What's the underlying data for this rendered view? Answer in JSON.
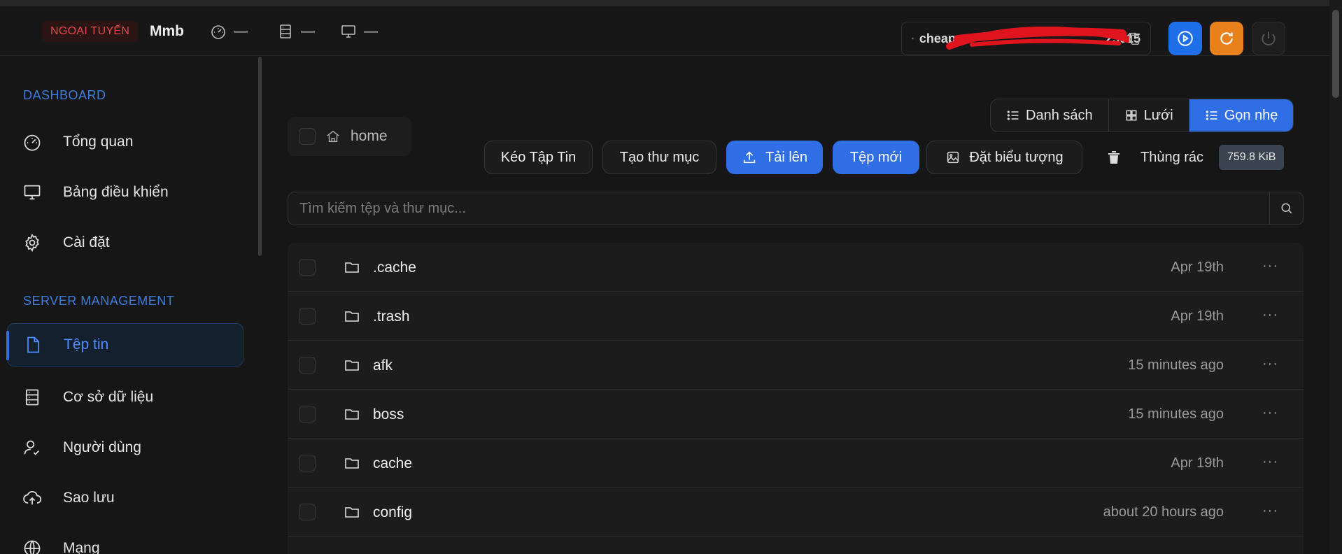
{
  "header": {
    "status": "NGOẠI TUYẾN",
    "server_name": "Mmb",
    "cpu": "—",
    "memory": "—",
    "disk": "—",
    "address_prefix": "cheap",
    "address_suffix": "25015"
  },
  "sidebar": {
    "dashboard_section": "DASHBOARD",
    "dashboard_items": [
      {
        "label": "Tổng quan",
        "icon": "gauge-icon"
      },
      {
        "label": "Bảng điều khiển",
        "icon": "monitor-icon"
      },
      {
        "label": "Cài đặt",
        "icon": "gear-icon"
      }
    ],
    "server_section": "SERVER MANAGEMENT",
    "server_items": [
      {
        "label": "Tệp tin",
        "icon": "file-icon",
        "active": true
      },
      {
        "label": "Cơ sở dữ liệu",
        "icon": "database-icon"
      },
      {
        "label": "Người dùng",
        "icon": "users-icon"
      },
      {
        "label": "Sao lưu",
        "icon": "cloud-upload-icon"
      },
      {
        "label": "Mạng",
        "icon": "globe-icon"
      }
    ]
  },
  "files": {
    "breadcrumb": "home",
    "view_modes": [
      "Danh sách",
      "Lưới",
      "Gọn nhẹ"
    ],
    "active_view": "Gọn nhẹ",
    "buttons": {
      "pull": "Kéo Tập Tin",
      "new_folder": "Tạo thư mục",
      "upload": "Tải lên",
      "new_file": "Tệp mới",
      "set_icon": "Đặt biểu tượng",
      "trash": "Thùng rác"
    },
    "usage": "759.8 KiB",
    "search_placeholder": "Tìm kiếm tệp và thư mục...",
    "rows": [
      {
        "name": ".cache",
        "date": "Apr 19th"
      },
      {
        "name": ".trash",
        "date": "Apr 19th"
      },
      {
        "name": "afk",
        "date": "15 minutes ago"
      },
      {
        "name": "boss",
        "date": "15 minutes ago"
      },
      {
        "name": "cache",
        "date": "Apr 19th"
      },
      {
        "name": "config",
        "date": "about 20 hours ago"
      }
    ]
  },
  "colors": {
    "accent": "#2f6ee5",
    "offline": "#e5484d",
    "restart": "#e8801c"
  }
}
